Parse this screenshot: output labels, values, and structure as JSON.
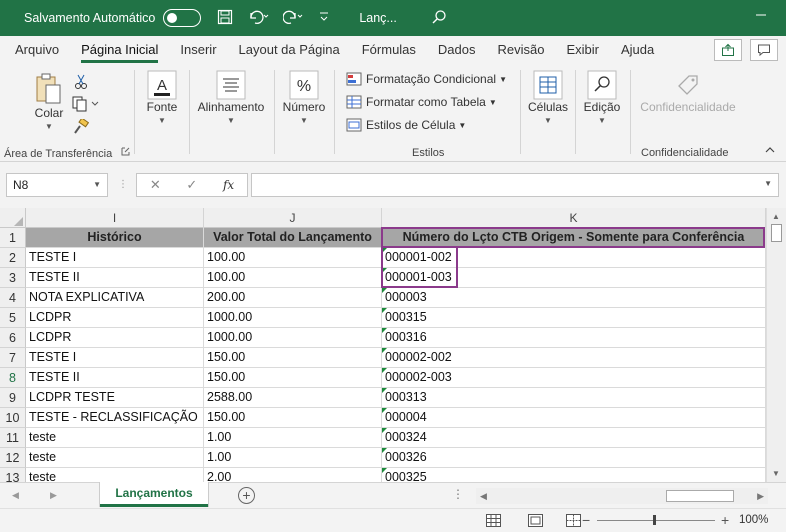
{
  "titlebar": {
    "autosave_label": "Salvamento Automático",
    "doc_name": "Lanç...",
    "accent": "#217346"
  },
  "menu": {
    "tabs": [
      "Arquivo",
      "Página Inicial",
      "Inserir",
      "Layout da Página",
      "Fórmulas",
      "Dados",
      "Revisão",
      "Exibir",
      "Ajuda"
    ],
    "active": "Página Inicial"
  },
  "ribbon": {
    "clipboard": {
      "paste_label": "Colar",
      "group_label": "Área de Transferência"
    },
    "font_label": "Fonte",
    "alignment_label": "Alinhamento",
    "number_label": "Número",
    "styles": {
      "conditional": "Formatação Condicional",
      "as_table": "Formatar como Tabela",
      "cell_styles": "Estilos de Célula",
      "group_label": "Estilos"
    },
    "cells_label": "Células",
    "editing_label": "Edição",
    "confidentiality": {
      "button_label": "Confidencialidade",
      "group_label": "Confidencialidade"
    }
  },
  "formula_bar": {
    "name_box": "N8",
    "fx_label": "fx",
    "formula": ""
  },
  "grid": {
    "columns": [
      "I",
      "J",
      "K"
    ],
    "header_row": {
      "num": "1",
      "cells": [
        "Histórico",
        "Valor Total do Lançamento",
        "Número do Lçto CTB Origem - Somente para Conferência"
      ]
    },
    "rows": [
      {
        "num": "2",
        "hist": "TESTE I",
        "valor": "100.00",
        "numero": "000001-002"
      },
      {
        "num": "3",
        "hist": "TESTE II",
        "valor": "100.00",
        "numero": "000001-003"
      },
      {
        "num": "4",
        "hist": "NOTA EXPLICATIVA",
        "valor": "200.00",
        "numero": "000003"
      },
      {
        "num": "5",
        "hist": "LCDPR",
        "valor": "1000.00",
        "numero": "000315"
      },
      {
        "num": "6",
        "hist": "LCDPR",
        "valor": "1000.00",
        "numero": "000316"
      },
      {
        "num": "7",
        "hist": "TESTE I",
        "valor": "150.00",
        "numero": "000002-002"
      },
      {
        "num": "8",
        "hist": "TESTE II",
        "valor": "150.00",
        "numero": "000002-003"
      },
      {
        "num": "9",
        "hist": "LCDPR TESTE",
        "valor": "2588.00",
        "numero": "000313"
      },
      {
        "num": "10",
        "hist": "TESTE - RECLASSIFICAÇÃO",
        "valor": "150.00",
        "numero": "000004"
      },
      {
        "num": "11",
        "hist": "teste",
        "valor": "1.00",
        "numero": "000324"
      },
      {
        "num": "12",
        "hist": "teste",
        "valor": "1.00",
        "numero": "000326"
      },
      {
        "num": "13",
        "hist": "teste",
        "valor": "2.00",
        "numero": "000325"
      }
    ],
    "highlight_color": "#8b3a8b"
  },
  "sheets": {
    "active": "Lançamentos"
  },
  "statusbar": {
    "zoom": "100%"
  }
}
